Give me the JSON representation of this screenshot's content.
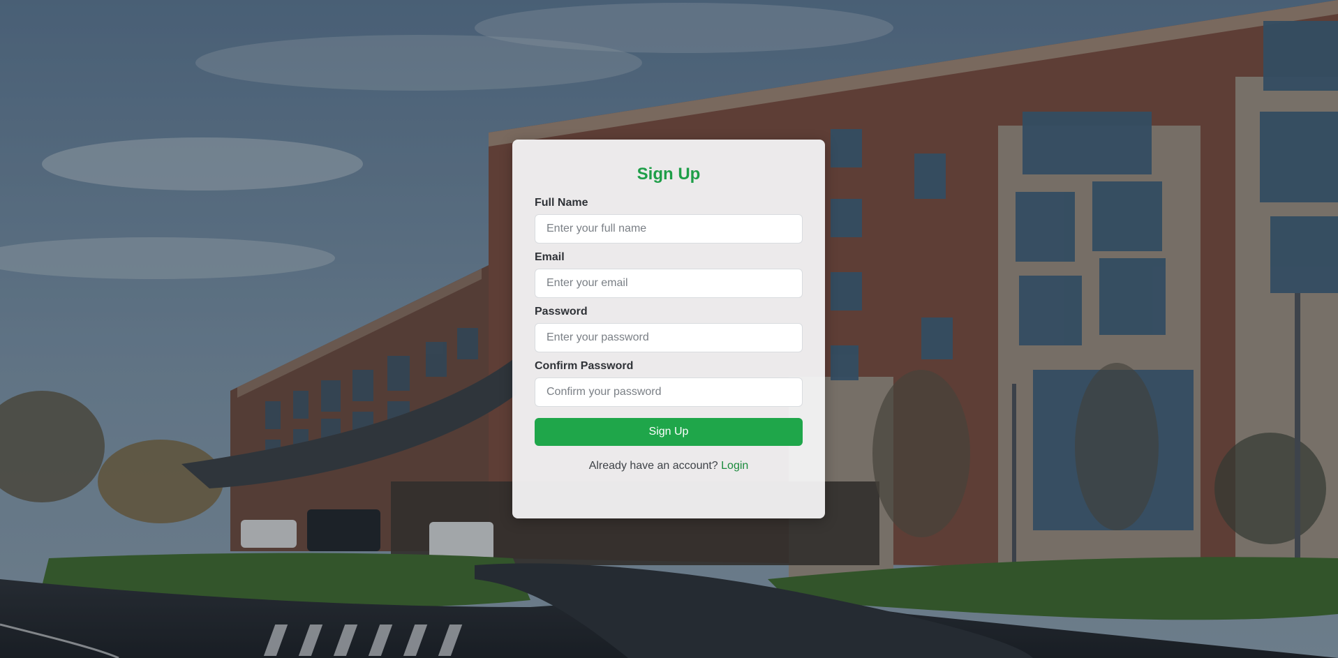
{
  "colors": {
    "accent": "#1e9e48",
    "title": "#1e9e48",
    "button_bg": "#1fa64a",
    "link": "#1a8a3c"
  },
  "background": {
    "description_icon": "hospital-building-photo"
  },
  "form": {
    "title": "Sign Up",
    "fields": [
      {
        "label": "Full Name",
        "placeholder": "Enter your full name",
        "value": ""
      },
      {
        "label": "Email",
        "placeholder": "Enter your email",
        "value": ""
      },
      {
        "label": "Password",
        "placeholder": "Enter your password",
        "value": ""
      },
      {
        "label": "Confirm Password",
        "placeholder": "Confirm your password",
        "value": ""
      }
    ],
    "submit_label": "Sign Up",
    "footer_text": "Already have an account?",
    "footer_link": "Login"
  }
}
